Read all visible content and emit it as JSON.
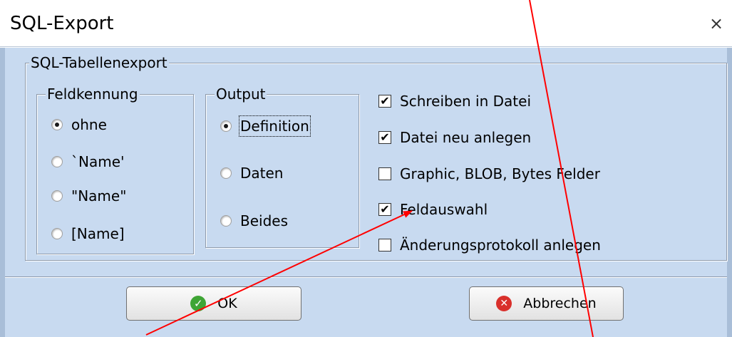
{
  "window": {
    "title": "SQL-Export",
    "close_glyph": "×"
  },
  "main_group": {
    "label": "SQL-Tabellenexport"
  },
  "field_id_group": {
    "label": "Feldkennung",
    "options": [
      {
        "label": "ohne",
        "selected": true
      },
      {
        "label": "`Name'",
        "selected": false
      },
      {
        "label": "\"Name\"",
        "selected": false
      },
      {
        "label": "[Name]",
        "selected": false
      }
    ]
  },
  "output_group": {
    "label": "Output",
    "options": [
      {
        "label": "Definition",
        "selected": true
      },
      {
        "label": "Daten",
        "selected": false
      },
      {
        "label": "Beides",
        "selected": false
      }
    ]
  },
  "checkboxes": [
    {
      "label": "Schreiben in Datei",
      "checked": true
    },
    {
      "label": "Datei neu anlegen",
      "checked": true
    },
    {
      "label": "Graphic, BLOB, Bytes Felder",
      "checked": false
    },
    {
      "label": "Feldauswahl",
      "checked": true
    },
    {
      "label": "Änderungsprotokoll anlegen",
      "checked": false
    }
  ],
  "buttons": {
    "ok_label": "OK",
    "ok_icon": "check-circle-icon",
    "cancel_label": "Abbrechen",
    "cancel_icon": "cancel-circle-icon"
  },
  "colors": {
    "dialog_bg": "#c8daf0",
    "annotation_arrow": "#ff0000",
    "ok_icon": "#3fa535",
    "cancel_icon": "#d9302b"
  }
}
